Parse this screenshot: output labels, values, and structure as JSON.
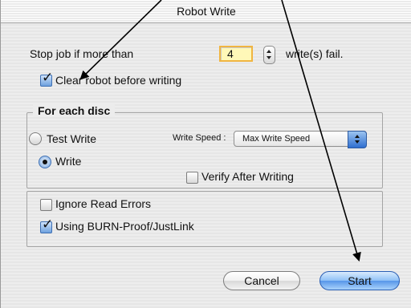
{
  "window": {
    "title": "Robot Write"
  },
  "stop_job": {
    "prefix_label": "Stop job if more than",
    "value": "4",
    "suffix_label": "write(s) fail."
  },
  "clear_robot": {
    "label": "Clear robot before writing",
    "checked": true
  },
  "for_each_disc": {
    "legend": "For each disc",
    "test_write_label": "Test Write",
    "write_label": "Write",
    "selected_mode": "Write",
    "write_speed_label": "Write Speed :",
    "write_speed_value": "Max Write Speed",
    "verify_after_writing_label": "Verify After Writing",
    "verify_after_writing_checked": false
  },
  "options": {
    "ignore_read_errors_label": "Ignore Read Errors",
    "ignore_read_errors_checked": false,
    "burn_proof_label": "Using BURN-Proof/JustLink",
    "burn_proof_checked": true
  },
  "buttons": {
    "cancel_label": "Cancel",
    "start_label": "Start"
  },
  "colors": {
    "field_highlight": "#fff8b8",
    "field_border": "#f0b541",
    "default_button": "#5796e9",
    "checkbox_checked": "#6ea1de"
  },
  "icons": {
    "checkbox_checked": "check-mark-icon",
    "radio_selected": "radio-dot-icon",
    "stepper": "up-down-stepper-icon",
    "popup": "up-down-popup-arrows-icon",
    "annotation": "arrow-annotation-icon"
  }
}
